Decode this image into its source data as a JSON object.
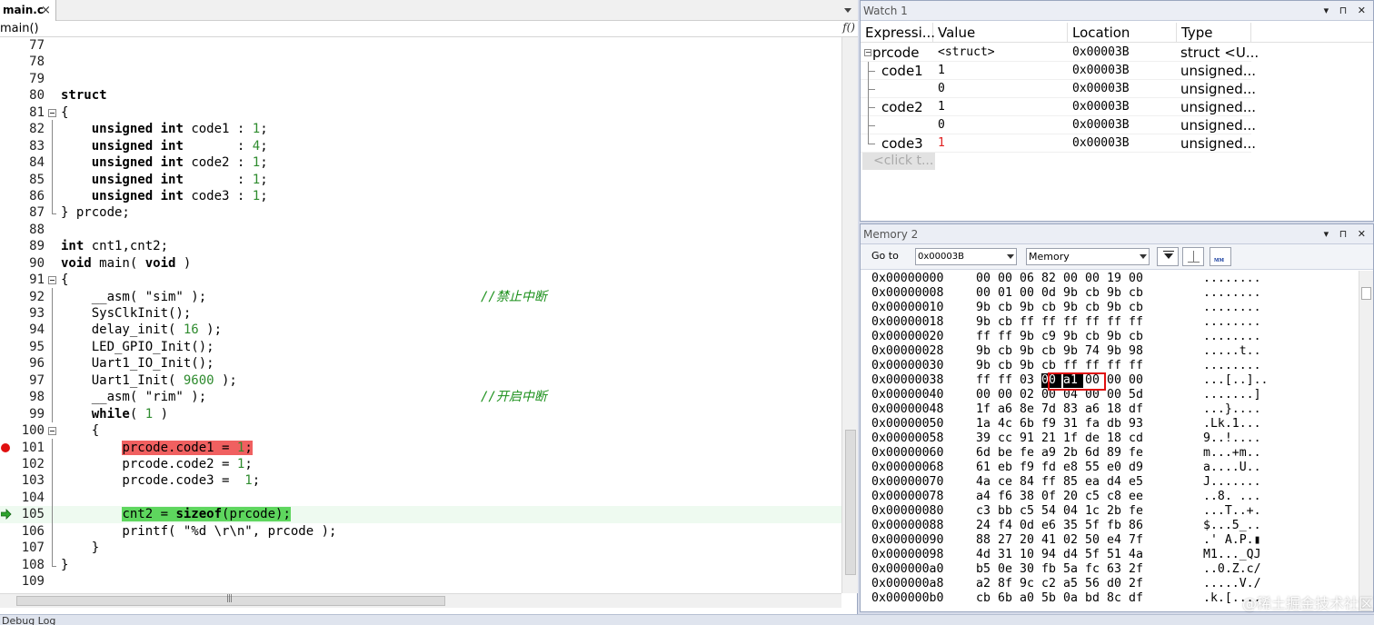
{
  "editor": {
    "tab_label": "main.c",
    "tab_close": "×",
    "function_name": "main()",
    "function_icon": "f()",
    "lines": [
      {
        "n": "77",
        "t": ""
      },
      {
        "n": "78",
        "t": ""
      },
      {
        "n": "79",
        "t": ""
      },
      {
        "n": "80",
        "t": "struct"
      },
      {
        "n": "81",
        "t": "{"
      },
      {
        "n": "82",
        "t": "    unsigned int code1 : 1;"
      },
      {
        "n": "83",
        "t": "    unsigned int       : 4;"
      },
      {
        "n": "84",
        "t": "    unsigned int code2 : 1;"
      },
      {
        "n": "85",
        "t": "    unsigned int       : 1;"
      },
      {
        "n": "86",
        "t": "    unsigned int code3 : 1;"
      },
      {
        "n": "87",
        "t": "} prcode;"
      },
      {
        "n": "88",
        "t": ""
      },
      {
        "n": "89",
        "t": "int cnt1,cnt2;"
      },
      {
        "n": "90",
        "t": "void main( void )"
      },
      {
        "n": "91",
        "t": "{"
      },
      {
        "n": "92",
        "t": "    __asm( \"sim\" );",
        "c": "//禁止中断"
      },
      {
        "n": "93",
        "t": "    SysClkInit();"
      },
      {
        "n": "94",
        "t": "    delay_init( 16 );"
      },
      {
        "n": "95",
        "t": "    LED_GPIO_Init();"
      },
      {
        "n": "96",
        "t": "    Uart1_IO_Init();"
      },
      {
        "n": "97",
        "t": "    Uart1_Init( 9600 );"
      },
      {
        "n": "98",
        "t": "    __asm( \"rim\" );",
        "c": "//开启中断"
      },
      {
        "n": "99",
        "t": "    while( 1 )"
      },
      {
        "n": "100",
        "t": "    {"
      },
      {
        "n": "101",
        "t": "prcode.code1 = 1;"
      },
      {
        "n": "102",
        "t": "        prcode.code2 = 1;"
      },
      {
        "n": "103",
        "t": "        prcode.code3 =  1;"
      },
      {
        "n": "104",
        "t": ""
      },
      {
        "n": "105",
        "t": "cnt2 = sizeof(prcode);"
      },
      {
        "n": "106",
        "t": "        printf( \"%d \\r\\n\", prcode );"
      },
      {
        "n": "107",
        "t": "    }"
      },
      {
        "n": "108",
        "t": "}"
      },
      {
        "n": "109",
        "t": ""
      }
    ]
  },
  "watch": {
    "title": "Watch 1",
    "panel_controls": "▾ ⊓ ✕",
    "headers": {
      "expression": "Expressi...",
      "value": "Value",
      "location": "Location",
      "type": "Type"
    },
    "rows": [
      {
        "expr": "prcode",
        "value": "<struct>",
        "location": "0x00003B",
        "type": "struct <U..."
      },
      {
        "expr": "code1",
        "value": "1",
        "location": "0x00003B",
        "type": "unsigned..."
      },
      {
        "expr": "",
        "value": "0",
        "location": "0x00003B",
        "type": "unsigned..."
      },
      {
        "expr": "code2",
        "value": "1",
        "location": "0x00003B",
        "type": "unsigned..."
      },
      {
        "expr": "",
        "value": "0",
        "location": "0x00003B",
        "type": "unsigned..."
      },
      {
        "expr": "code3",
        "value": "1",
        "location": "0x00003B",
        "type": "unsigned..."
      }
    ],
    "changed_color": "#e02020",
    "add_placeholder": "<click t..."
  },
  "memory": {
    "title": "Memory 2",
    "panel_controls": "▾ ⊓ ✕",
    "goto_label": "Go to",
    "goto_value": "0x00003B",
    "type_value": "Memory",
    "rows": [
      {
        "a": "0x00000000",
        "b": [
          "00",
          "00",
          "06",
          "82",
          "00",
          "00",
          "19",
          "00"
        ],
        "s": "........"
      },
      {
        "a": "0x00000008",
        "b": [
          "00",
          "01",
          "00",
          "0d",
          "9b",
          "cb",
          "9b",
          "cb"
        ],
        "s": "........"
      },
      {
        "a": "0x00000010",
        "b": [
          "9b",
          "cb",
          "9b",
          "cb",
          "9b",
          "cb",
          "9b",
          "cb"
        ],
        "s": "........"
      },
      {
        "a": "0x00000018",
        "b": [
          "9b",
          "cb",
          "ff",
          "ff",
          "ff",
          "ff",
          "ff",
          "ff"
        ],
        "s": "........"
      },
      {
        "a": "0x00000020",
        "b": [
          "ff",
          "ff",
          "9b",
          "c9",
          "9b",
          "cb",
          "9b",
          "cb"
        ],
        "s": "........"
      },
      {
        "a": "0x00000028",
        "b": [
          "9b",
          "cb",
          "9b",
          "cb",
          "9b",
          "74",
          "9b",
          "98"
        ],
        "s": ".....t.."
      },
      {
        "a": "0x00000030",
        "b": [
          "9b",
          "cb",
          "9b",
          "cb",
          "ff",
          "ff",
          "ff",
          "ff"
        ],
        "s": "........"
      },
      {
        "a": "0x00000038",
        "b": [
          "ff",
          "ff",
          "03",
          "00",
          "a1",
          "00",
          "00",
          "00"
        ],
        "s": "...[..].."
      },
      {
        "a": "0x00000040",
        "b": [
          "00",
          "00",
          "02",
          "00",
          "04",
          "00",
          "00",
          "5d"
        ],
        "s": ".......]"
      },
      {
        "a": "0x00000048",
        "b": [
          "1f",
          "a6",
          "8e",
          "7d",
          "83",
          "a6",
          "18",
          "df"
        ],
        "s": "...}...."
      },
      {
        "a": "0x00000050",
        "b": [
          "1a",
          "4c",
          "6b",
          "f9",
          "31",
          "fa",
          "db",
          "93"
        ],
        "s": ".Lk.1..."
      },
      {
        "a": "0x00000058",
        "b": [
          "39",
          "cc",
          "91",
          "21",
          "1f",
          "de",
          "18",
          "cd"
        ],
        "s": "9..!...."
      },
      {
        "a": "0x00000060",
        "b": [
          "6d",
          "be",
          "fe",
          "a9",
          "2b",
          "6d",
          "89",
          "fe"
        ],
        "s": "m...+m.."
      },
      {
        "a": "0x00000068",
        "b": [
          "61",
          "eb",
          "f9",
          "fd",
          "e8",
          "55",
          "e0",
          "d9"
        ],
        "s": "a....U.."
      },
      {
        "a": "0x00000070",
        "b": [
          "4a",
          "ce",
          "84",
          "ff",
          "85",
          "ea",
          "d4",
          "e5"
        ],
        "s": "J......."
      },
      {
        "a": "0x00000078",
        "b": [
          "a4",
          "f6",
          "38",
          "0f",
          "20",
          "c5",
          "c8",
          "ee"
        ],
        "s": "..8. ..."
      },
      {
        "a": "0x00000080",
        "b": [
          "c3",
          "bb",
          "c5",
          "54",
          "04",
          "1c",
          "2b",
          "fe"
        ],
        "s": "...T..+."
      },
      {
        "a": "0x00000088",
        "b": [
          "24",
          "f4",
          "0d",
          "e6",
          "35",
          "5f",
          "fb",
          "86"
        ],
        "s": "$...5_.."
      },
      {
        "a": "0x00000090",
        "b": [
          "88",
          "27",
          "20",
          "41",
          "02",
          "50",
          "e4",
          "7f"
        ],
        "s": ".' A.P.▮"
      },
      {
        "a": "0x00000098",
        "b": [
          "4d",
          "31",
          "10",
          "94",
          "d4",
          "5f",
          "51",
          "4a"
        ],
        "s": "M1..._QJ"
      },
      {
        "a": "0x000000a0",
        "b": [
          "b5",
          "0e",
          "30",
          "fb",
          "5a",
          "fc",
          "63",
          "2f"
        ],
        "s": "..0.Z.c/"
      },
      {
        "a": "0x000000a8",
        "b": [
          "a2",
          "8f",
          "9c",
          "c2",
          "a5",
          "56",
          "d0",
          "2f"
        ],
        "s": ".....V./"
      },
      {
        "a": "0x000000b0",
        "b": [
          "cb",
          "6b",
          "a0",
          "5b",
          "0a",
          "bd",
          "8c",
          "df"
        ],
        "s": ".k.[...."
      }
    ]
  },
  "watermark": "@稀土掘金技术社区",
  "debug_log_label": "Debug Log"
}
